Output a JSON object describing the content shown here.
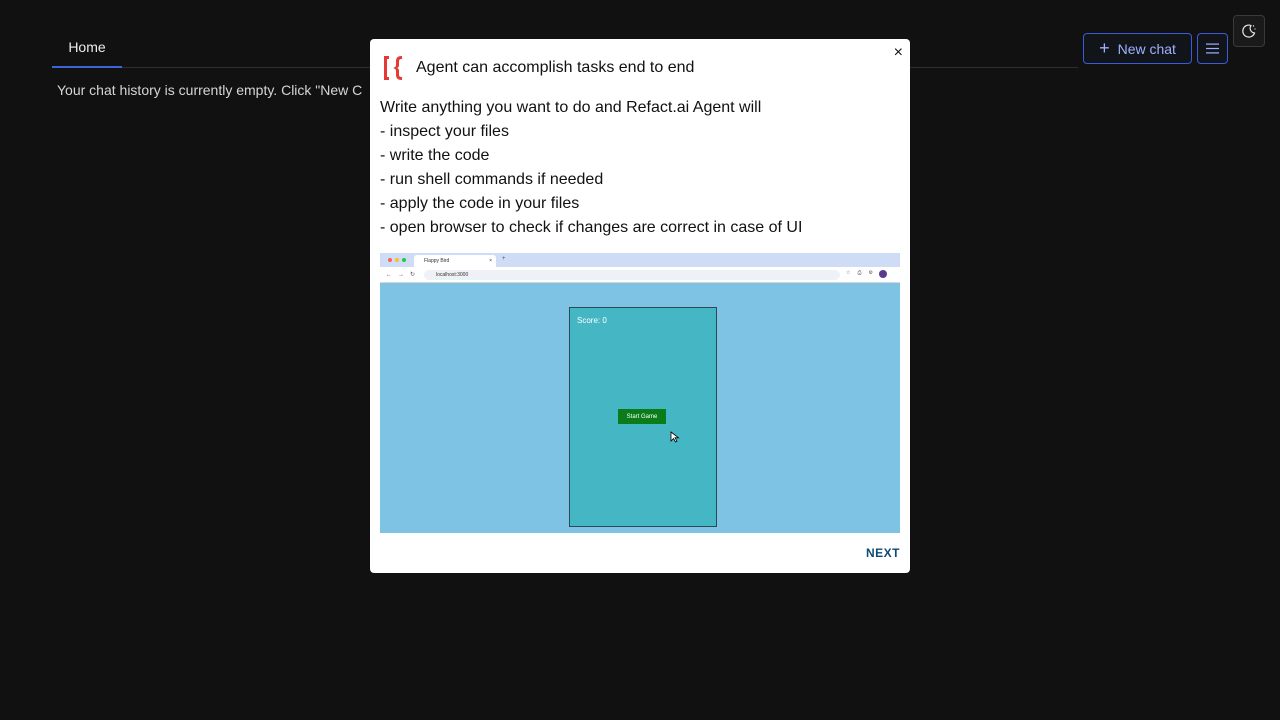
{
  "app": {
    "tabs": [
      {
        "label": "Home"
      }
    ],
    "empty_message": "Your chat history is currently empty. Click \"New C",
    "new_chat_label": "New chat"
  },
  "modal": {
    "close_label": "×",
    "title": "Agent can accomplish tasks end to end",
    "body_lines": [
      "Write anything you want to do and Refact.ai Agent will",
      "- inspect your files",
      "- write the code",
      "- run shell commands if needed",
      "- apply the code in your files",
      "- open browser to check if changes are correct in case of UI"
    ],
    "preview": {
      "browser_tab_title": "Flappy Bird",
      "browser_tab_close": "×",
      "browser_newtab": "+",
      "url": "localhost:3000",
      "score_text": "Score: 0",
      "start_button_label": "Start Game"
    },
    "next_label": "NEXT"
  },
  "colors": {
    "background": "#111111",
    "accent": "#3e63dd",
    "logo_red": "#e53935",
    "game_bg": "#7ec3e3",
    "game_canvas": "#45b6c4",
    "start_button": "#0a7d1a",
    "next_text": "#0b4a75"
  }
}
